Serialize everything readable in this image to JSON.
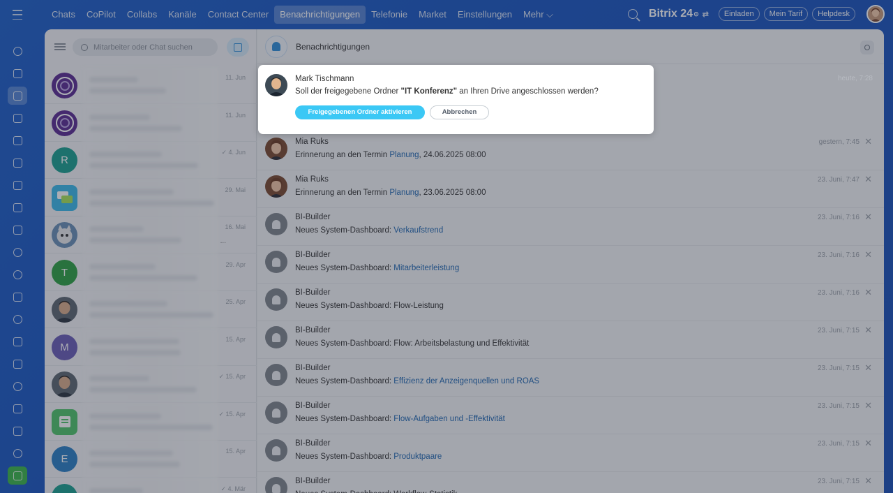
{
  "topnav": {
    "items": [
      "Chats",
      "CoPilot",
      "Collabs",
      "Kanäle",
      "Contact Center",
      "Benachrichtigungen",
      "Telefonie",
      "Market",
      "Einstellungen",
      "Mehr ⌵"
    ],
    "active_index": 5,
    "brand": "Bitrix 24",
    "buttons": [
      "Einladen",
      "Mein Tarif",
      "Helpdesk"
    ]
  },
  "chatlist": {
    "search_placeholder": "Mitarbeiter oder Chat suchen",
    "rows": [
      {
        "date": "11. Jun",
        "avatar": "purple-icon"
      },
      {
        "date": "11. Jun",
        "avatar": "purple-icon"
      },
      {
        "date": "✓ 4. Jun",
        "avatar": "letter",
        "letter": "R",
        "color": "#1a9e8f"
      },
      {
        "date": "29. Mai",
        "avatar": "chat-icon"
      },
      {
        "date": "16. Mai",
        "avatar": "cat-photo",
        "extra": "..."
      },
      {
        "date": "29. Apr",
        "avatar": "letter",
        "letter": "T",
        "color": "#2ea043"
      },
      {
        "date": "25. Apr",
        "avatar": "person-photo"
      },
      {
        "date": "15. Apr",
        "avatar": "letter",
        "letter": "M",
        "color": "#6a5cb5"
      },
      {
        "date": "✓ 15. Apr",
        "avatar": "person-photo"
      },
      {
        "date": "✓ 15. Apr",
        "avatar": "green-icon"
      },
      {
        "date": "15. Apr",
        "avatar": "letter",
        "letter": "E",
        "color": "#2b7fc4"
      },
      {
        "date": "✓ 4. Mär",
        "avatar": "letter",
        "letter": "",
        "color": "#1a9e8f"
      }
    ]
  },
  "notifications": {
    "title": "Benachrichtigungen",
    "popup": {
      "author": "Mark Tischmann",
      "text_before": "Soll der freigegebene Ordner ",
      "text_bold": "\"IT Konferenz\"",
      "text_after": " an Ihren Drive angeschlossen werden?",
      "time": "heute, 7:28",
      "primary_button": "Freigegebenen Ordner aktivieren",
      "cancel_button": "Abbrechen"
    },
    "items": [
      {
        "author": "Mia Ruks",
        "prefix": "Erinnerung an den Termin ",
        "link": "Planung",
        "suffix": ", 24.06.2025 08:00",
        "time": "gestern, 7:45",
        "avatar": "photo"
      },
      {
        "author": "Mia Ruks",
        "prefix": "Erinnerung an den Termin ",
        "link": "Planung",
        "suffix": ", 23.06.2025 08:00",
        "time": "23. Juni, 7:47",
        "avatar": "photo"
      },
      {
        "author": "BI-Builder",
        "prefix": "Neues System-Dashboard: ",
        "link": "Verkaufstrend",
        "suffix": "",
        "time": "23. Juni, 7:16",
        "avatar": "bell"
      },
      {
        "author": "BI-Builder",
        "prefix": "Neues System-Dashboard: ",
        "link": "Mitarbeiterleistung",
        "suffix": "",
        "time": "23. Juni, 7:16",
        "avatar": "bell"
      },
      {
        "author": "BI-Builder",
        "prefix": "Neues System-Dashboard: Flow-Leistung",
        "link": "",
        "suffix": "",
        "time": "23. Juni, 7:16",
        "avatar": "bell"
      },
      {
        "author": "BI-Builder",
        "prefix": "Neues System-Dashboard: Flow: Arbeitsbelastung und Effektivität",
        "link": "",
        "suffix": "",
        "time": "23. Juni, 7:15",
        "avatar": "bell"
      },
      {
        "author": "BI-Builder",
        "prefix": "Neues System-Dashboard: ",
        "link": "Effizienz der Anzeigenquellen und ROAS",
        "suffix": "",
        "time": "23. Juni, 7:15",
        "avatar": "bell"
      },
      {
        "author": "BI-Builder",
        "prefix": "Neues System-Dashboard: ",
        "link": "Flow-Aufgaben und -Effektivität",
        "suffix": "",
        "time": "23. Juni, 7:15",
        "avatar": "bell"
      },
      {
        "author": "BI-Builder",
        "prefix": "Neues System-Dashboard: ",
        "link": "Produktpaare",
        "suffix": "",
        "time": "23. Juni, 7:15",
        "avatar": "bell"
      },
      {
        "author": "BI-Builder",
        "prefix": "Neues System-Dashboard: Workflow-Statistik",
        "link": "",
        "suffix": "",
        "time": "23. Juni, 7:15",
        "avatar": "bell"
      }
    ]
  },
  "close_glyph": "✕"
}
